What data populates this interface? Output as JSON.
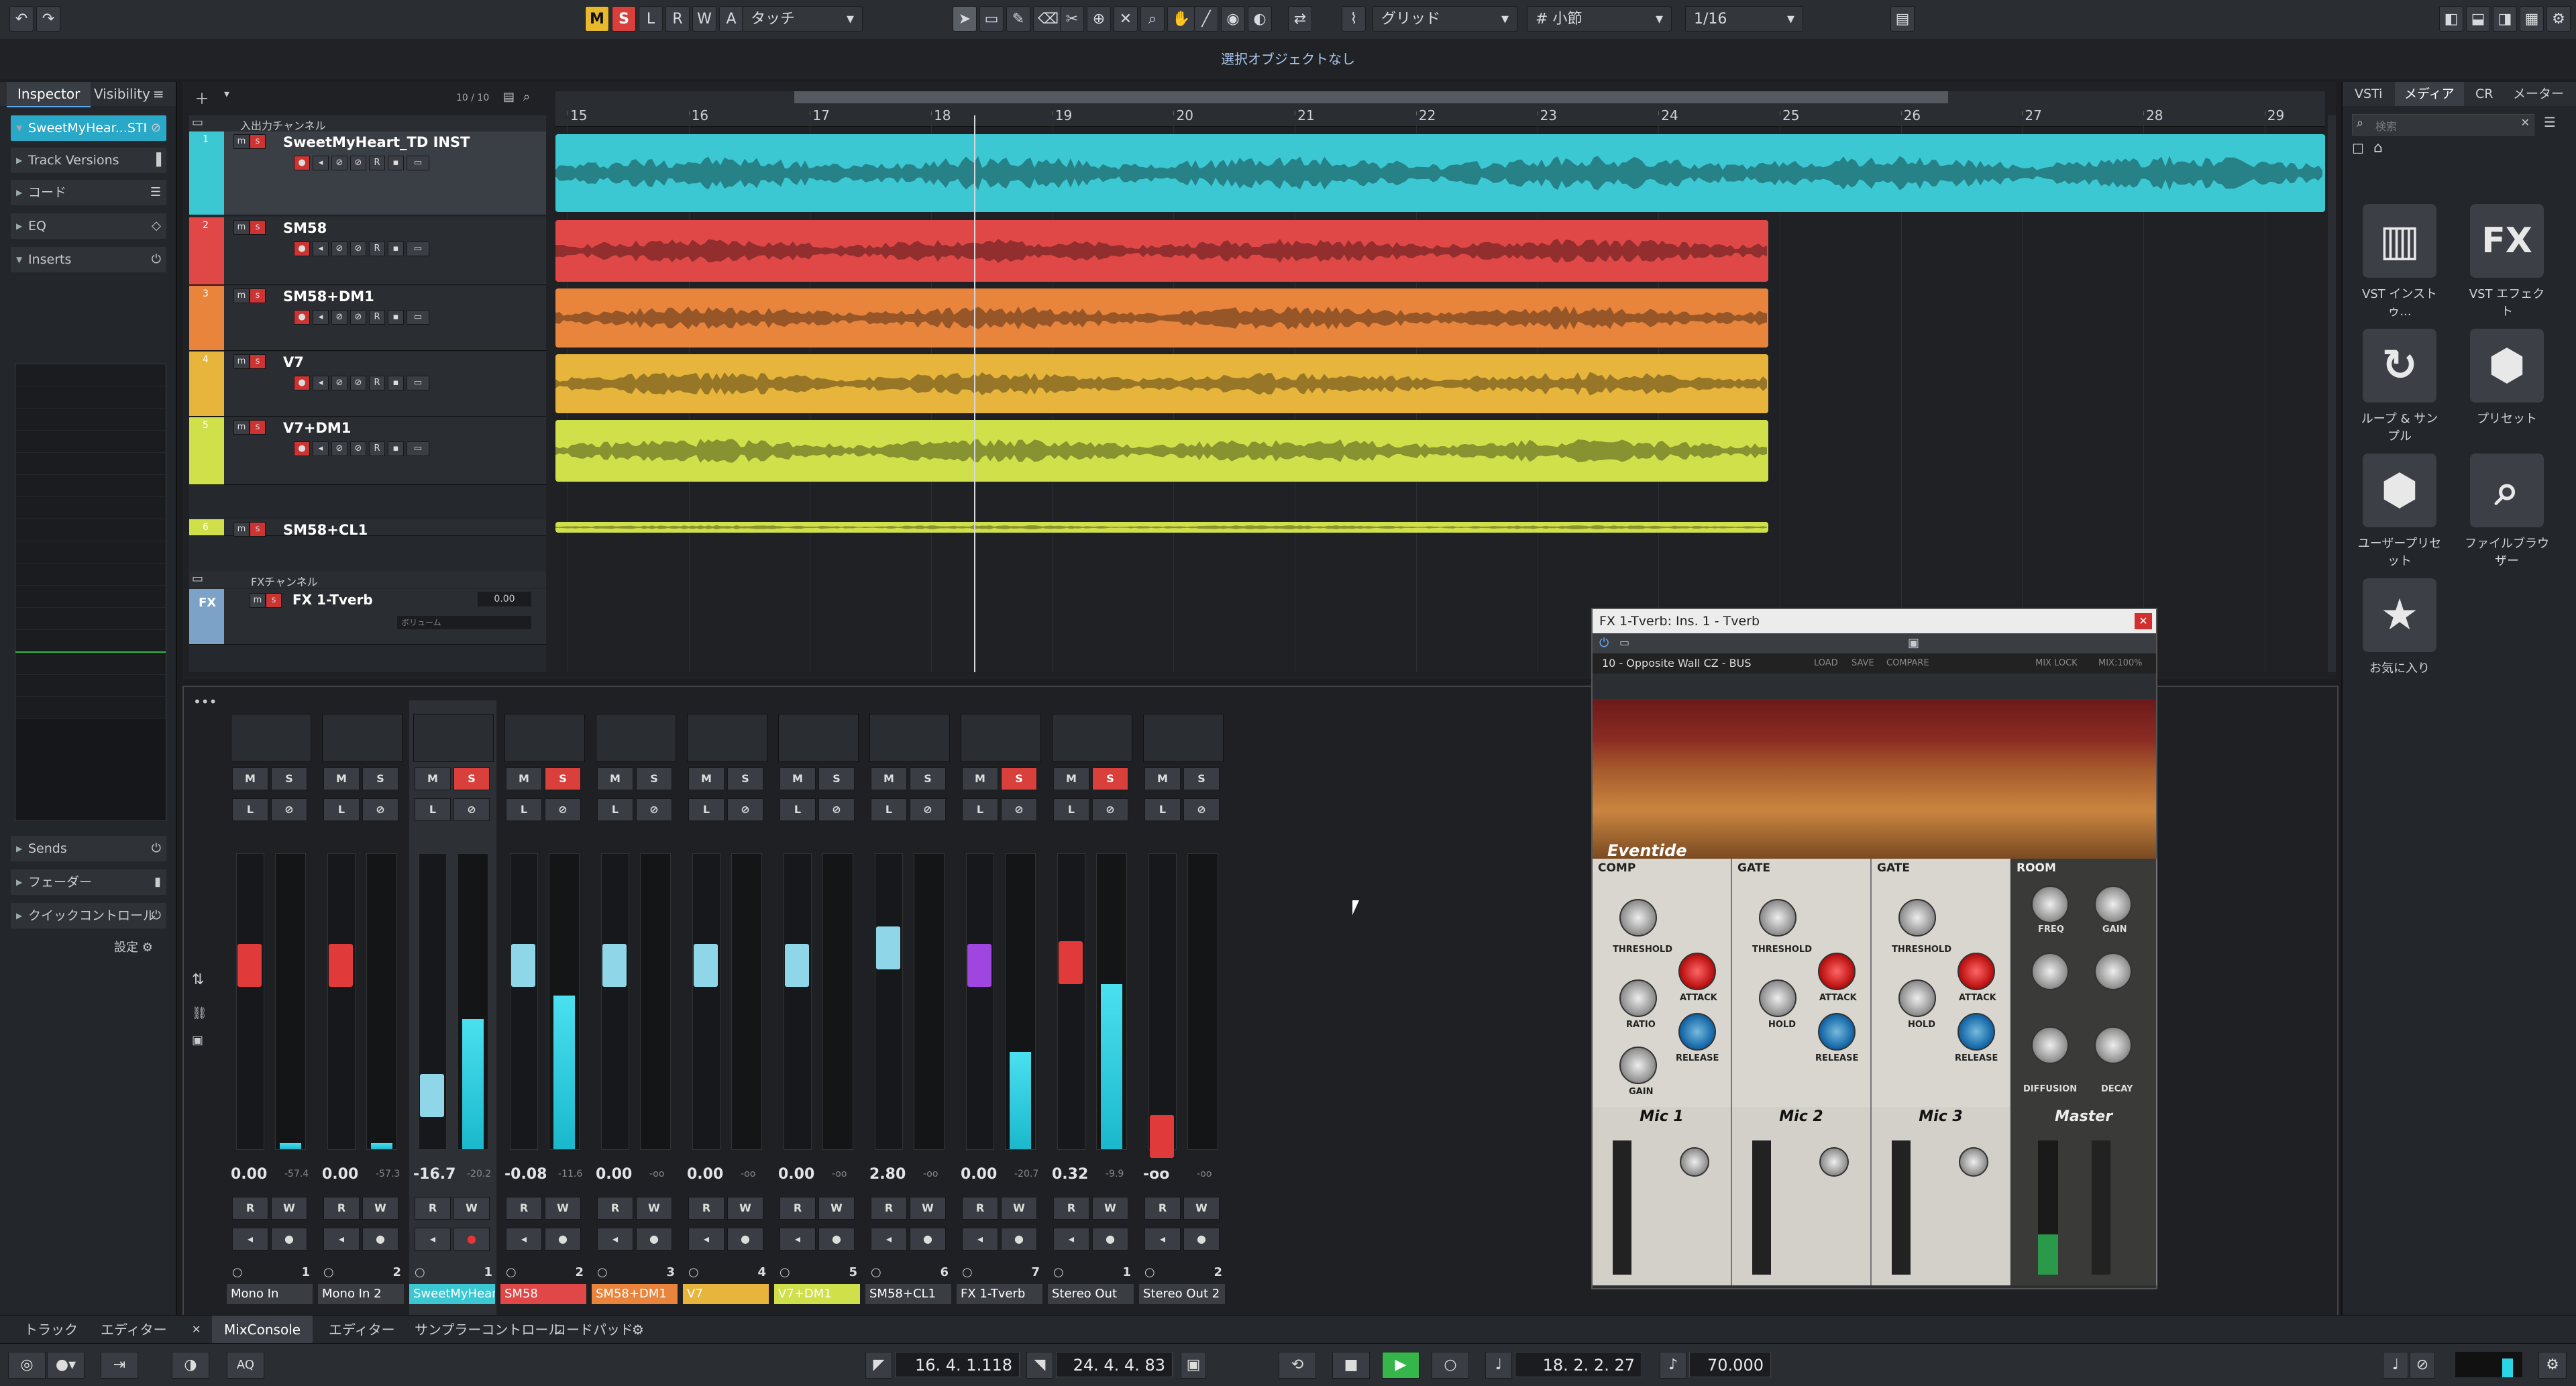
{
  "toolbar": {
    "undo": "↶",
    "redo": "↷",
    "m": "M",
    "s": "S",
    "l": "L",
    "r": "R",
    "w": "W",
    "a": "A",
    "automation_mode": "タッチ",
    "grid_type": "グリッド",
    "grid_size": "小節",
    "quantize": "1/16"
  },
  "status": {
    "message": "選択オブジェクトなし"
  },
  "inspector": {
    "tabs": [
      "Inspector",
      "Visibility"
    ],
    "track_name": "SweetMyHear...STI",
    "rows": [
      "Track Versions",
      "コード",
      "EQ",
      "Inserts",
      "Sends",
      "フェーダー",
      "クイックコントロール"
    ],
    "settings": "設定"
  },
  "arrange": {
    "counter": "10 / 10",
    "ruler": [
      "15",
      "16",
      "17",
      "18",
      "19",
      "20",
      "21",
      "22",
      "23",
      "24",
      "25",
      "26",
      "27",
      "28",
      "29"
    ],
    "folder_io": "入出力チャンネル",
    "folder_fx": "FXチャンネル",
    "tracks": [
      {
        "num": "1",
        "name": "SweetMyHeart_TD INST",
        "color": "#3cc8d2"
      },
      {
        "num": "2",
        "name": "SM58",
        "color": "#e04848"
      },
      {
        "num": "3",
        "name": "SM58+DM1",
        "color": "#e8843c"
      },
      {
        "num": "4",
        "name": "V7",
        "color": "#e8b53c"
      },
      {
        "num": "5",
        "name": "V7+DM1",
        "color": "#cfe04a"
      },
      {
        "num": "6",
        "name": "SM58+CL1",
        "color": "#cfe04a"
      }
    ],
    "fx_track": {
      "name": "FX 1-Tverb",
      "value": "0.00",
      "vol_label": "ボリューム",
      "icon": "FX"
    }
  },
  "media": {
    "tabs": [
      "VSTi",
      "メディア",
      "CR",
      "メーター"
    ],
    "search_placeholder": "検索",
    "items": [
      {
        "label": "VST インストゥ...",
        "icon": "▥"
      },
      {
        "label": "VST エフェクト",
        "icon": "FX"
      },
      {
        "label": "ループ & サンプル",
        "icon": "↻"
      },
      {
        "label": "プリセット",
        "icon": "⬢"
      },
      {
        "label": "ユーザープリセット",
        "icon": "⬢"
      },
      {
        "label": "ファイルブラウザー",
        "icon": "⌕"
      },
      {
        "label": "お気に入り",
        "icon": "★"
      }
    ]
  },
  "mixer": {
    "channels": [
      {
        "name": "Mono In",
        "num": "1",
        "value": "0.00",
        "peak": "-57.4",
        "fader": 0.62,
        "meter": 0.02,
        "cap": "#e03a3a",
        "color": "#3a3d42",
        "mute": "M",
        "solo": "S",
        "solo_on": false
      },
      {
        "name": "Mono In 2",
        "num": "2",
        "value": "0.00",
        "peak": "-57.3",
        "fader": 0.62,
        "meter": 0.02,
        "cap": "#e03a3a",
        "color": "#3a3d42",
        "mute": "M",
        "solo": "S",
        "solo_on": false
      },
      {
        "name": "SweetMyHeart",
        "num": "1",
        "value": "-16.7",
        "peak": "-20.2",
        "fader": 0.18,
        "meter": 0.44,
        "cap": "#8fd6e8",
        "color": "#3cc8d2",
        "mute": "M",
        "solo": "S",
        "solo_on": true
      },
      {
        "name": "SM58",
        "num": "2",
        "value": "-0.08",
        "peak": "-11.6",
        "fader": 0.62,
        "meter": 0.52,
        "cap": "#8fd6e8",
        "color": "#e04848",
        "mute": "M",
        "solo": "S",
        "solo_on": true
      },
      {
        "name": "SM58+DM1",
        "num": "3",
        "value": "0.00",
        "peak": "-oo",
        "fader": 0.62,
        "meter": 0.0,
        "cap": "#8fd6e8",
        "color": "#e8843c",
        "mute": "M",
        "solo": "S",
        "solo_on": false
      },
      {
        "name": "V7",
        "num": "4",
        "value": "0.00",
        "peak": "-oo",
        "fader": 0.62,
        "meter": 0.0,
        "cap": "#8fd6e8",
        "color": "#e8b53c",
        "mute": "M",
        "solo": "S",
        "solo_on": false
      },
      {
        "name": "V7+DM1",
        "num": "5",
        "value": "0.00",
        "peak": "-oo",
        "fader": 0.62,
        "meter": 0.0,
        "cap": "#8fd6e8",
        "color": "#cfe04a",
        "mute": "M",
        "solo": "S",
        "solo_on": false
      },
      {
        "name": "SM58+CL1",
        "num": "6",
        "value": "2.80",
        "peak": "-oo",
        "fader": 0.68,
        "meter": 0.0,
        "cap": "#8fd6e8",
        "color": "#3a3d42",
        "mute": "M",
        "solo": "S",
        "solo_on": false
      },
      {
        "name": "FX 1-Tverb",
        "num": "7",
        "value": "0.00",
        "peak": "-20.7",
        "fader": 0.62,
        "meter": 0.33,
        "cap": "#a046e0",
        "color": "#3a3d42",
        "mute": "M",
        "solo": "S",
        "solo_on": true
      },
      {
        "name": "Stereo Out",
        "num": "1",
        "value": "0.32",
        "peak": "-9.9",
        "fader": 0.63,
        "meter": 0.56,
        "cap": "#e03a3a",
        "color": "#3a3d42",
        "mute": "M",
        "solo": "S",
        "solo_on": true
      },
      {
        "name": "Stereo Out 2",
        "num": "2",
        "value": "-oo",
        "peak": "-oo",
        "fader": 0.04,
        "meter": 0.0,
        "cap": "#e03a3a",
        "color": "#3a3d42",
        "mute": "M",
        "solo": "S",
        "solo_on": false
      }
    ]
  },
  "plugin": {
    "title": "FX 1-Tverb: Ins. 1 - Tverb",
    "preset": "10 - Opposite Wall CZ - BUS",
    "buttons": [
      "LOAD",
      "SAVE",
      "COMPARE",
      "MIX LOCK",
      "MIX:100%"
    ],
    "brand": "Eventide",
    "sections": [
      "COMP",
      "GATE",
      "GATE",
      "ROOM"
    ],
    "labels": [
      "THRESHOLD",
      "ATTACK",
      "RATIO",
      "RELEASE",
      "GAIN",
      "HOLD",
      "FREQ",
      "DIFFUSION",
      "DECAY"
    ],
    "mics": [
      "Mic 1",
      "Mic 2",
      "Mic 3",
      "Master"
    ]
  },
  "bottom_tabs": [
    "トラック",
    "エディター",
    "MixConsole",
    "エディター",
    "サンプラーコントロール",
    "コードパッド"
  ],
  "transport": {
    "left_locator": "16. 4. 1.118",
    "right_locator": "24. 4. 4. 83",
    "position": "18. 2. 2. 27",
    "tempo": "70.000",
    "aq": "AQ"
  }
}
